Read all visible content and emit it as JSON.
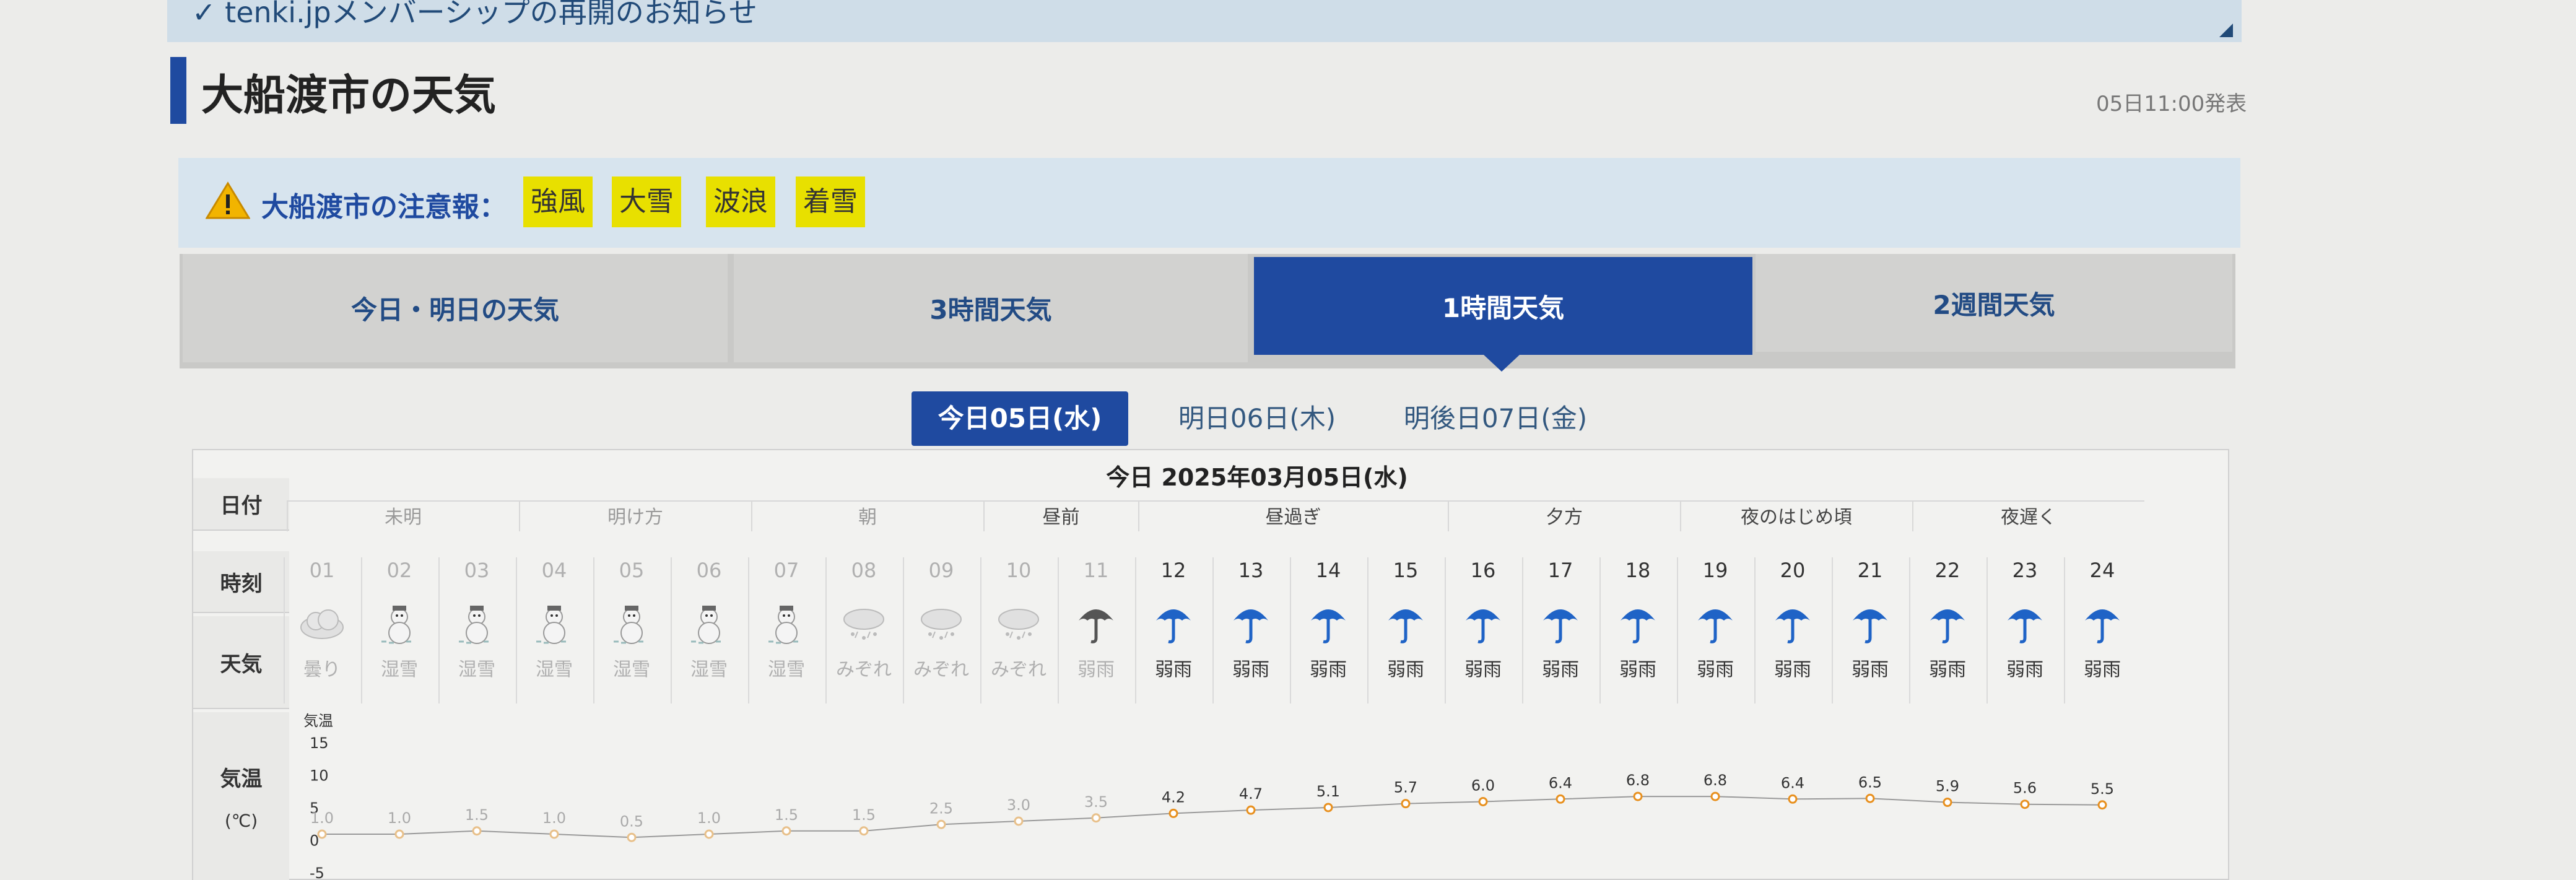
{
  "notice": {
    "text": "✓ tenki.jpメンバーシップの再開のお知らせ"
  },
  "page": {
    "title": "大船渡市の天気",
    "published": "05日11:00発表"
  },
  "warning": {
    "label": "大船渡市の注意報：",
    "badges": [
      "強風",
      "大雪",
      "波浪",
      "着雪"
    ],
    "icon": "warning-triangle-icon"
  },
  "tabs": [
    {
      "label": "今日・明日の天気",
      "active": false
    },
    {
      "label": "3時間天気",
      "active": false
    },
    {
      "label": "1時間天気",
      "active": true
    },
    {
      "label": "2週間天気",
      "active": false
    }
  ],
  "day_tabs": [
    {
      "label": "今日05日(水)",
      "active": true
    },
    {
      "label": "明日06日(木)",
      "active": false
    },
    {
      "label": "明後日07日(金)",
      "active": false
    }
  ],
  "table": {
    "row_headers": {
      "date": "日付",
      "time": "時刻",
      "weather": "天気",
      "temp": "気温",
      "temp_unit": "(℃)"
    },
    "date": "今日 2025年03月05日(水)",
    "periods": [
      "未明",
      "明け方",
      "朝",
      "昼前",
      "昼過ぎ",
      "夕方",
      "夜のはじめ頃",
      "夜遅く"
    ],
    "hours": [
      "01",
      "02",
      "03",
      "04",
      "05",
      "06",
      "07",
      "08",
      "09",
      "10",
      "11",
      "12",
      "13",
      "14",
      "15",
      "16",
      "17",
      "18",
      "19",
      "20",
      "21",
      "22",
      "23",
      "24"
    ],
    "weather": [
      "曇り",
      "湿雪",
      "湿雪",
      "湿雪",
      "湿雪",
      "湿雪",
      "湿雪",
      "みぞれ",
      "みぞれ",
      "みぞれ",
      "弱雨",
      "弱雨",
      "弱雨",
      "弱雨",
      "弱雨",
      "弱雨",
      "弱雨",
      "弱雨",
      "弱雨",
      "弱雨",
      "弱雨",
      "弱雨",
      "弱雨",
      "弱雨"
    ],
    "icons": [
      "cloudy-icon",
      "snowman-icon",
      "snowman-icon",
      "snowman-icon",
      "snowman-icon",
      "snowman-icon",
      "snowman-icon",
      "sleet-icon",
      "sleet-icon",
      "sleet-icon",
      "umbrella-icon",
      "umbrella-icon",
      "umbrella-icon",
      "umbrella-icon",
      "umbrella-icon",
      "umbrella-icon",
      "umbrella-icon",
      "umbrella-icon",
      "umbrella-icon",
      "umbrella-icon",
      "umbrella-icon",
      "umbrella-icon",
      "umbrella-icon",
      "umbrella-icon"
    ]
  },
  "chart_data": {
    "type": "line",
    "ylabel": "気温",
    "y_ticks": [
      "15",
      "10",
      "5",
      "0",
      "-5"
    ],
    "ylim": [
      -5,
      15
    ],
    "x": [
      "01",
      "02",
      "03",
      "04",
      "05",
      "06",
      "07",
      "08",
      "09",
      "10",
      "11",
      "12",
      "13",
      "14",
      "15",
      "16",
      "17",
      "18",
      "19",
      "20",
      "21",
      "22",
      "23",
      "24"
    ],
    "values": [
      1.0,
      1.0,
      1.5,
      1.0,
      0.5,
      1.0,
      1.5,
      1.5,
      2.5,
      3.0,
      3.5,
      4.2,
      4.7,
      5.1,
      5.7,
      6.0,
      6.4,
      6.8,
      6.8,
      6.4,
      6.5,
      5.9,
      5.6,
      5.5
    ],
    "value_labels": [
      "1.0",
      "1.0",
      "1.5",
      "1.0",
      "0.5",
      "1.0",
      "1.5",
      "1.5",
      "2.5",
      "3.0",
      "3.5",
      "4.2",
      "4.7",
      "5.1",
      "5.7",
      "6.0",
      "6.4",
      "6.8",
      "6.8",
      "6.4",
      "6.5",
      "5.9",
      "5.6",
      "5.5"
    ],
    "point_color": "#e8901e",
    "past_hours": 11
  },
  "colors": {
    "accent": "#1f4aa0",
    "badge": "#e8e000",
    "umbrella": "#1f63c6"
  }
}
